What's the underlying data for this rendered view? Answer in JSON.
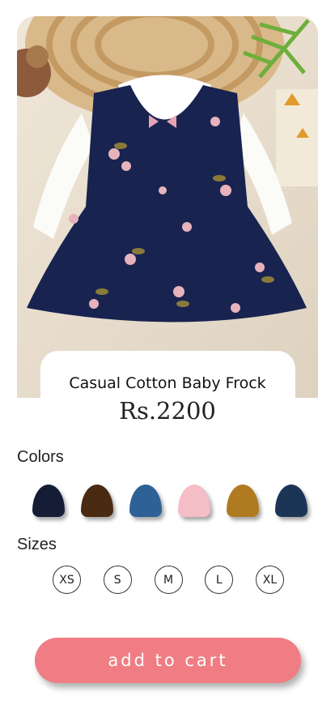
{
  "product": {
    "name": "Casual Cotton Baby Frock",
    "price": "Rs.2200",
    "image_icon": "baby-frock-photo"
  },
  "colors": {
    "label": "Colors",
    "options": [
      {
        "hex": "#141d35"
      },
      {
        "hex": "#4a2a13"
      },
      {
        "hex": "#2e6196"
      },
      {
        "hex": "#f5bdc6"
      },
      {
        "hex": "#b07a20"
      },
      {
        "hex": "#1c3557"
      }
    ]
  },
  "sizes": {
    "label": "Sizes",
    "options": [
      "XS",
      "S",
      "M",
      "L",
      "XL"
    ]
  },
  "actions": {
    "add_to_cart_label": "add to cart",
    "accent": "#ef7d83"
  }
}
